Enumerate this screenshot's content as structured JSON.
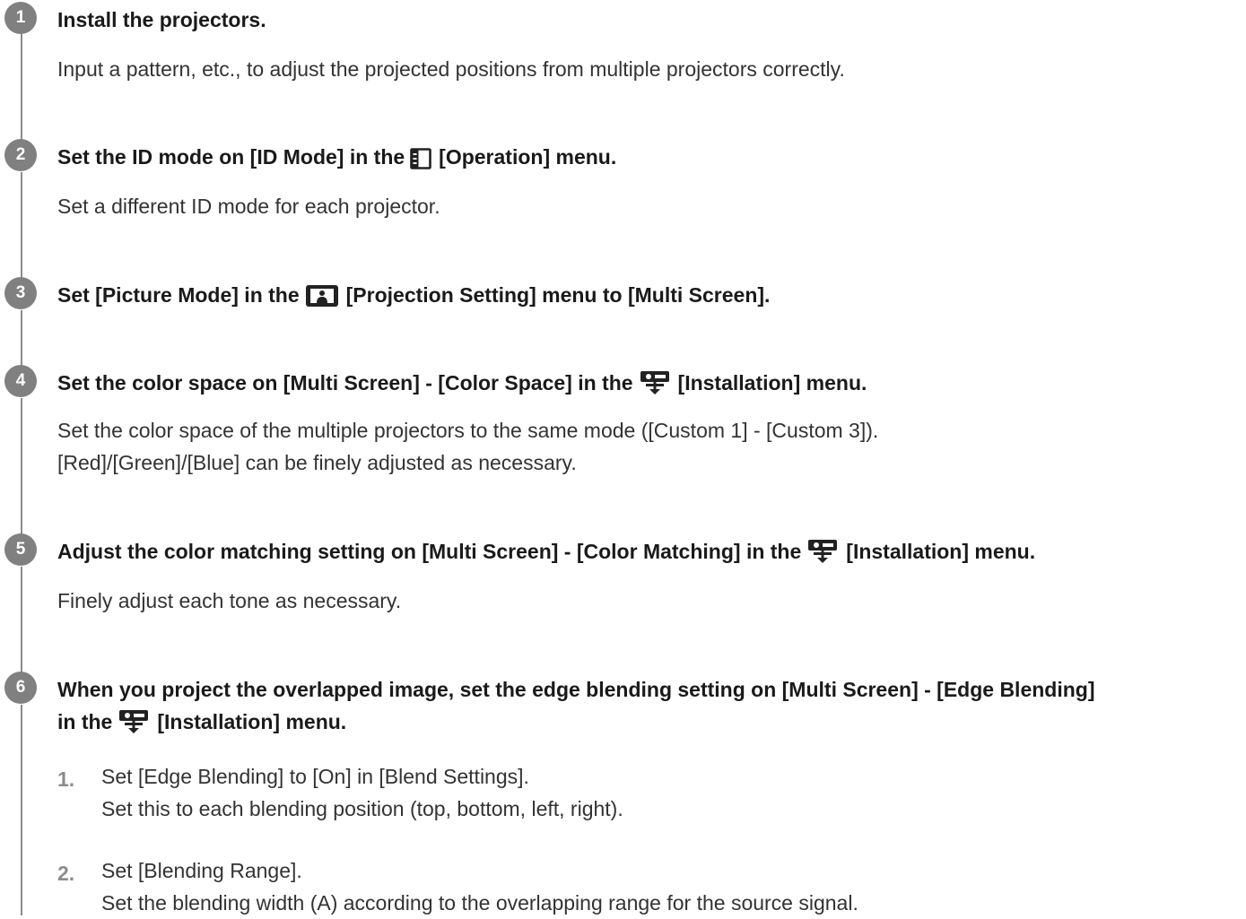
{
  "steps": [
    {
      "number": "1",
      "title": "Install the projectors.",
      "description": "Input a pattern, etc., to adjust the projected positions from multiple projectors correctly."
    },
    {
      "number": "2",
      "title_before_icon": "Set the ID mode on [ID Mode] in the",
      "icon": "operation-menu-icon",
      "title_after_icon": "[Operation] menu.",
      "description": "Set a different ID mode for each projector."
    },
    {
      "number": "3",
      "title_before_icon": "Set [Picture Mode] in the",
      "icon": "projection-setting-menu-icon",
      "title_after_icon": "[Projection Setting] menu to [Multi Screen]."
    },
    {
      "number": "4",
      "title_before_icon": "Set the color space on [Multi Screen] - [Color Space] in the",
      "icon": "installation-menu-icon",
      "title_after_icon": "[Installation] menu.",
      "description_line1": "Set the color space of the multiple projectors to the same mode ([Custom 1] - [Custom 3]).",
      "description_line2": "[Red]/[Green]/[Blue] can be finely adjusted as necessary."
    },
    {
      "number": "5",
      "title_before_icon": "Adjust the color matching setting on [Multi Screen] - [Color Matching] in the",
      "icon": "installation-menu-icon",
      "title_after_icon": "[Installation] menu.",
      "description": "Finely adjust each tone as necessary."
    },
    {
      "number": "6",
      "title_line1": "When you project the overlapped image, set the edge blending setting on [Multi Screen] - [Edge Blending]",
      "title_line2_before_icon": "in the",
      "icon": "installation-menu-icon",
      "title_line2_after_icon": "[Installation] menu.",
      "substeps": [
        {
          "number": "1.",
          "line1": "Set [Edge Blending] to [On] in [Blend Settings].",
          "line2": "Set this to each blending position (top, bottom, left, right)."
        },
        {
          "number": "2.",
          "line1": "Set [Blending Range].",
          "line2": "Set the blending width (A) according to the overlapping range for the source signal."
        }
      ]
    }
  ],
  "colors": {
    "step_badge": "#808080",
    "timeline_line": "#8c8c8c",
    "title_text": "#1a1a1a",
    "body_text": "#333333",
    "substep_number": "#8c8c8c",
    "icon_fill": "#222222"
  }
}
